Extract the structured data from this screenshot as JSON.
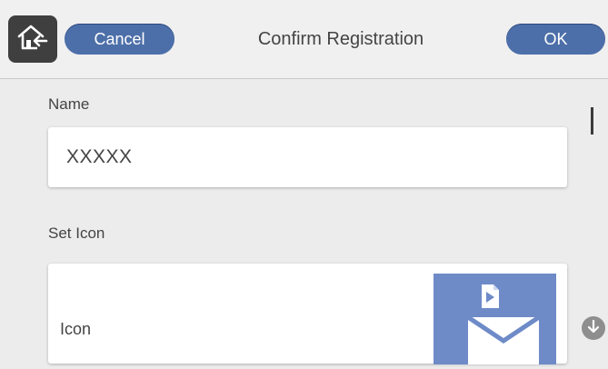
{
  "header": {
    "home_icon": "home-back-icon",
    "cancel_label": "Cancel",
    "title": "Confirm Registration",
    "ok_label": "OK"
  },
  "form": {
    "name_label": "Name",
    "name_value": "XXXXX",
    "set_icon_label": "Set Icon",
    "icon_row_label": "Icon",
    "icon_preview": "document-envelope-icon"
  },
  "scroll": {
    "down_icon": "arrow-down-icon"
  },
  "colors": {
    "accent": "#4d6fa9",
    "icon_tile": "#6e8bc8",
    "background": "#ececec"
  }
}
